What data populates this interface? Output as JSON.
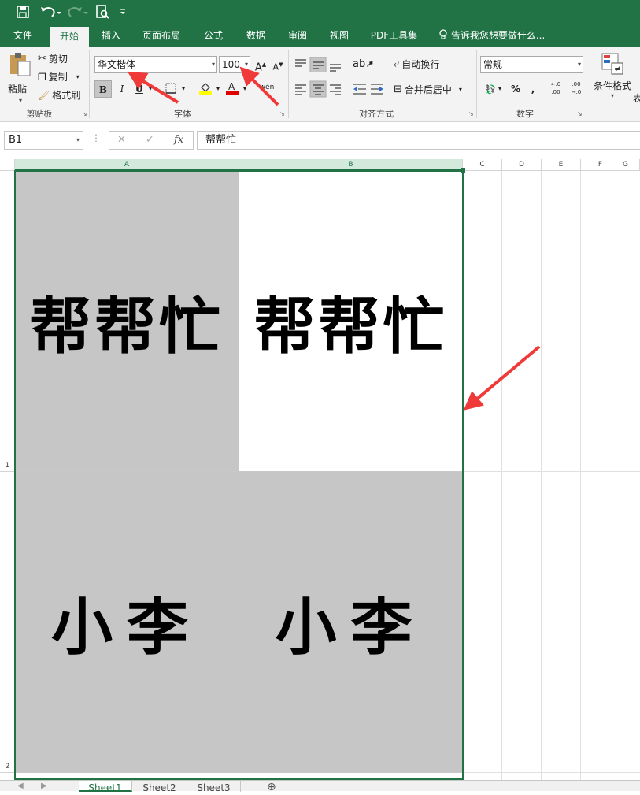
{
  "quick_access": {
    "save_icon": "save-icon",
    "undo_icon": "undo-icon",
    "redo_icon": "redo-icon",
    "preview_icon": "print-preview-icon",
    "customize_icon": "customize-qat-icon"
  },
  "tabs": [
    {
      "label": "文件"
    },
    {
      "label": "开始"
    },
    {
      "label": "插入"
    },
    {
      "label": "页面布局"
    },
    {
      "label": "公式"
    },
    {
      "label": "数据"
    },
    {
      "label": "审阅"
    },
    {
      "label": "视图"
    },
    {
      "label": "PDF工具集"
    }
  ],
  "tell_me": "告诉我您想要做什么...",
  "clipboard": {
    "paste": "粘贴",
    "cut": "剪切",
    "copy": "复制",
    "format_painter": "格式刷",
    "group": "剪贴板"
  },
  "font": {
    "name": "华文楷体",
    "size": "100",
    "grow": "A",
    "shrink": "A",
    "bold": "B",
    "italic": "I",
    "underline": "U",
    "phonetic": "wén",
    "group": "字体"
  },
  "alignment": {
    "wrap": "自动换行",
    "merge": "合并后居中",
    "group": "对齐方式"
  },
  "number": {
    "format": "常规",
    "percent": "%",
    "comma": ",",
    "inc_decimal": "←.0 .00",
    "dec_decimal": ".00 →.0",
    "group": "数字"
  },
  "styles": {
    "conditional": "条件格式",
    "partial": "表"
  },
  "formula_bar": {
    "name_box": "B1",
    "cancel": "✕",
    "enter": "✓",
    "fx": "fx",
    "content": "帮帮忙"
  },
  "columns": [
    "A",
    "B",
    "C",
    "D",
    "E",
    "F",
    "G"
  ],
  "rows": [
    "1",
    "2"
  ],
  "cells": {
    "a1": "帮帮忙",
    "b1": "帮帮忙",
    "a2": "小李",
    "b2": "小李"
  },
  "sheets": [
    {
      "label": "Sheet1"
    },
    {
      "label": "Sheet2"
    },
    {
      "label": "Sheet3"
    }
  ],
  "add_sheet": "⊕",
  "colors": {
    "excel_green": "#217346",
    "annotation_red": "#f03a3a",
    "cell_gray": "#c6c6c6"
  }
}
